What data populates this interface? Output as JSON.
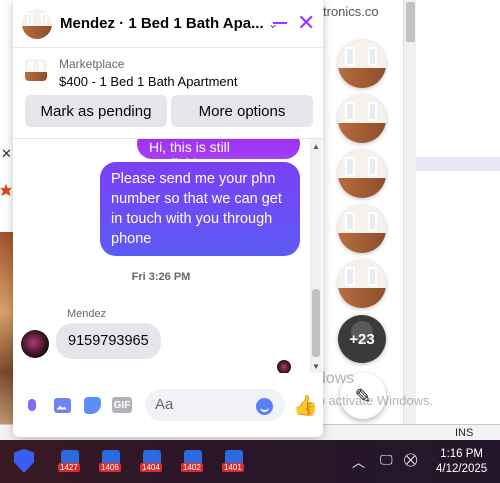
{
  "background": {
    "site_title": "tronics.co",
    "status_ins": "INS",
    "watermark_line1": "Activate Windows",
    "watermark_line2": "Go to Settings to activate Windows."
  },
  "chat": {
    "title": "Mendez · 1 Bed 1 Bath Apa...",
    "listing": {
      "label": "Marketplace",
      "title": "$400 - 1 Bed 1 Bath Apartment"
    },
    "actions": {
      "mark_pending": "Mark as pending",
      "more_options": "More options"
    },
    "messages": {
      "partial_sent": "Hi, this is still available",
      "sent": "Please send me your phn number so that we can get in touch with you through phone",
      "timestamp": "Fri 3:26 PM",
      "sender_name": "Mendez",
      "received": "9159793965"
    },
    "composer": {
      "placeholder": "Aa",
      "gif_label": "GIF"
    }
  },
  "chat_heads": {
    "more_count": "+23"
  },
  "taskbar": {
    "badges": [
      "1427",
      "1406",
      "1404",
      "1402",
      "1401"
    ],
    "time": "1:16 PM",
    "date": "4/12/2025"
  }
}
